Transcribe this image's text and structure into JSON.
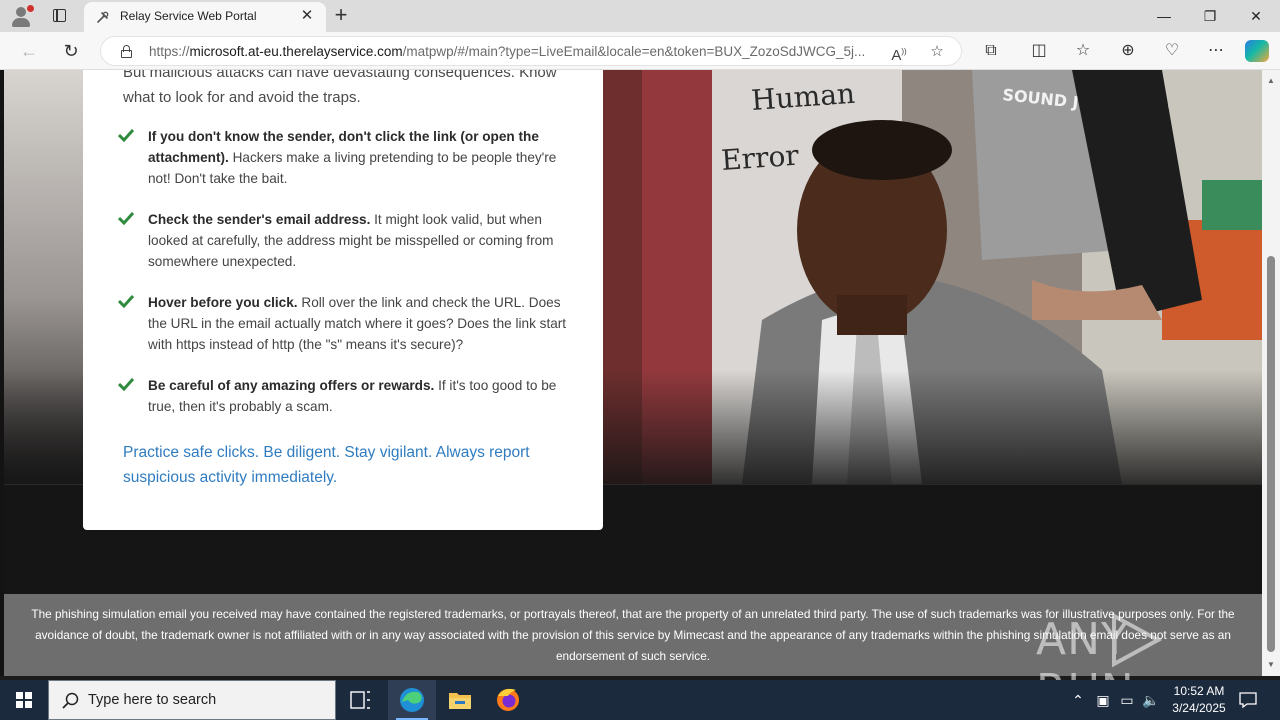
{
  "browser": {
    "tab_title": "Relay Service Web Portal",
    "close_tab": "✕",
    "new_tab": "+",
    "url_prefix": "https://",
    "url_host": "microsoft.at-eu.therelayservice.com",
    "url_path": "/matpwp/#/main?type=LiveEmail&locale=en&token=BUX_ZozoSdJWCG_5j...",
    "window": {
      "minimize": "—",
      "restore": "❐",
      "close": "✕"
    }
  },
  "card": {
    "intro": "But malicious attacks can have devastating consequences. Know what to look for and avoid the traps.",
    "tips": [
      {
        "bold": "If you don't know the sender, don't click the link (or open the attachment).",
        "text": " Hackers make a living pretending to be people they're not! Don't take the bait."
      },
      {
        "bold": "Check the sender's email address.",
        "text": " It might look valid, but when looked at carefully, the address might be misspelled or coming from somewhere unexpected."
      },
      {
        "bold": "Hover before you click.",
        "text": " Roll over the link and check the URL. Does the URL in the email actually match where it goes? Does the link start with https instead of http (the \"s\" means it's secure)?"
      },
      {
        "bold": "Be careful of any amazing offers or rewards.",
        "text": " If it's too good to be true, then it's probably a scam."
      }
    ],
    "closing": "Practice safe clicks. Be diligent. Stay vigilant. Always report suspicious activity immediately."
  },
  "hero": {
    "shirt_text_1": "Human",
    "shirt_text_2": "Error",
    "shirt_text_3": "SOUND JUDGMENT"
  },
  "disclaimer": "The phishing simulation email you received may have contained the registered trademarks, or portrayals thereof, that are the property of an unrelated third party. The use of such trademarks was for illustrative purposes only. For the avoidance of doubt, the trademark owner is not affiliated with or in any way associated with the provision of this service by Mimecast and the appearance of any trademarks within the phishing simulation email does not serve as an endorsement of such service.",
  "watermark": "ANY RUN",
  "taskbar": {
    "search_placeholder": "Type here to search",
    "time": "10:52 AM",
    "date": "3/24/2025"
  },
  "colors": {
    "accent_link": "#2f7cc1",
    "check_green": "#2e8b3d",
    "taskbar": "#1c2a3e"
  }
}
